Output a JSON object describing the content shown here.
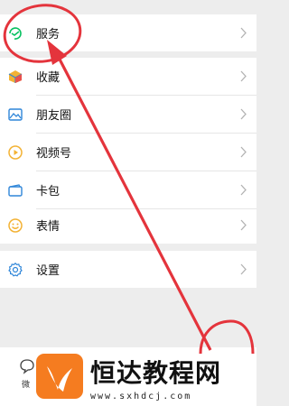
{
  "menu": {
    "items": [
      {
        "label": "服务",
        "icon": "service-icon"
      },
      {
        "label": "收藏",
        "icon": "favorites-icon"
      },
      {
        "label": "朋友圈",
        "icon": "moments-icon"
      },
      {
        "label": "视频号",
        "icon": "channels-icon"
      },
      {
        "label": "卡包",
        "icon": "card-wallet-icon"
      },
      {
        "label": "表情",
        "icon": "sticker-icon"
      },
      {
        "label": "设置",
        "icon": "settings-icon"
      }
    ]
  },
  "tabbar": {
    "chat_label": "微"
  },
  "watermark": {
    "brand": "恒达教程网",
    "url": "www.sxhdcj.com"
  },
  "colors": {
    "annotation_red": "#e4343c",
    "accent_green": "#07c160",
    "watermark_orange": "#f57c20"
  }
}
